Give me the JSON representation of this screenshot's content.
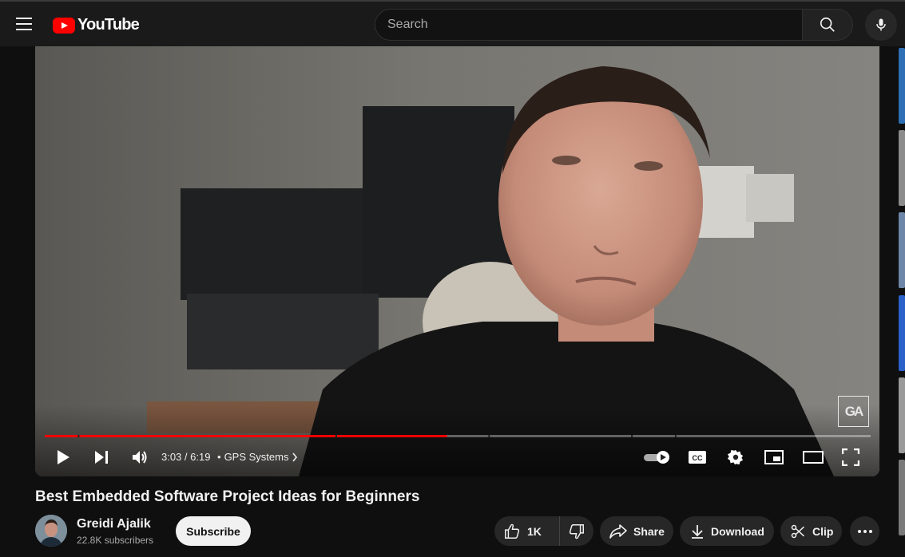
{
  "header": {
    "logo_text": "YouTube",
    "search_placeholder": "Search"
  },
  "player": {
    "progress_fraction": 0.487,
    "chapter_marks": [
      0.04,
      0.352,
      0.537,
      0.71,
      0.763
    ],
    "time_display": "3:03 / 6:19",
    "separator": "•",
    "chapter_label": "GPS Systems",
    "watermark": "GA"
  },
  "video": {
    "title": "Best Embedded Software Project Ideas for Beginners"
  },
  "channel": {
    "name": "Greidi Ajalik",
    "subscribers": "22.8K subscribers",
    "subscribe_label": "Subscribe"
  },
  "actions": {
    "likes": "1K",
    "share_label": "Share",
    "download_label": "Download",
    "clip_label": "Clip"
  },
  "colors": {
    "accent": "#ff0000",
    "background": "#0f0f0f",
    "pill": "#272727"
  }
}
